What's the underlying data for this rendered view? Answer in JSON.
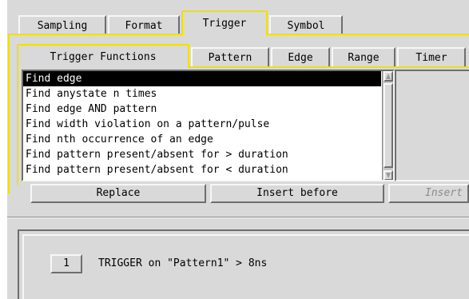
{
  "main_tabs": [
    "Sampling",
    "Format",
    "Trigger",
    "Symbol"
  ],
  "active_main_tab": "Trigger",
  "sub_tabs": [
    "Trigger Functions",
    "Pattern",
    "Edge",
    "Range",
    "Timer"
  ],
  "active_sub_tab": "Trigger Functions",
  "functions_list": [
    "Find edge",
    "Find anystate n times",
    "Find edge AND pattern",
    "Find width violation on a pattern/pulse",
    "Find nth occurrence of an edge",
    "Find pattern present/absent for > duration",
    "Find pattern present/absent for < duration"
  ],
  "selected_function": "Find edge",
  "buttons": {
    "replace": "Replace",
    "insert_before": "Insert before",
    "insert_after": "Insert"
  },
  "sequence": {
    "step_number": "1",
    "step_text": "TRIGGER on \"Pattern1\" > 8ns"
  },
  "colors": {
    "active_tab_outline": "#f0e000",
    "panel": "#d9d9d9",
    "selection": "#000000"
  }
}
